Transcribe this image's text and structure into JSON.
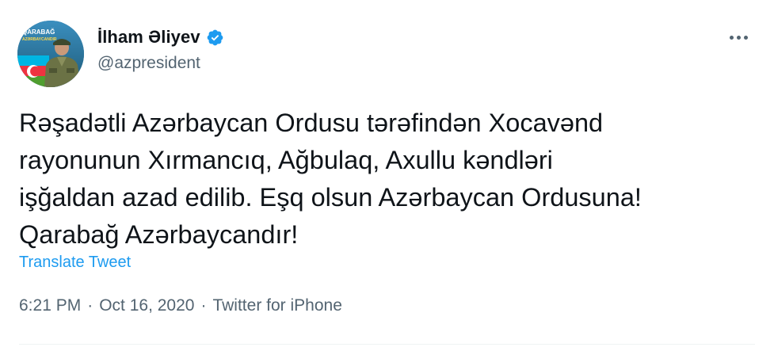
{
  "author": {
    "display_name": "İlham Əliyev",
    "handle": "@azpresident",
    "avatar_text": "QARABAĞ AZƏRBAYCANDIR"
  },
  "tweet": {
    "text": "Rəşadətli Azərbaycan Ordusu tərəfindən Xocavənd\nrayonunun Xırmancıq, Ağbulaq, Axullu kəndləri\nişğaldan azad edilib. Eşq olsun Azərbaycan Ordusuna!\nQarabağ Azərbaycandır!",
    "translate_label": "Translate Tweet"
  },
  "meta": {
    "time": "6:21 PM",
    "separator": "·",
    "date": "Oct 16, 2020",
    "source": "Twitter for iPhone"
  },
  "colors": {
    "accent": "#1d9bf0",
    "text_primary": "#0f1419",
    "text_secondary": "#536471",
    "verified": "#1d9bf0"
  },
  "icons": {
    "verified": "verified-badge-icon",
    "more": "more-options-icon"
  }
}
